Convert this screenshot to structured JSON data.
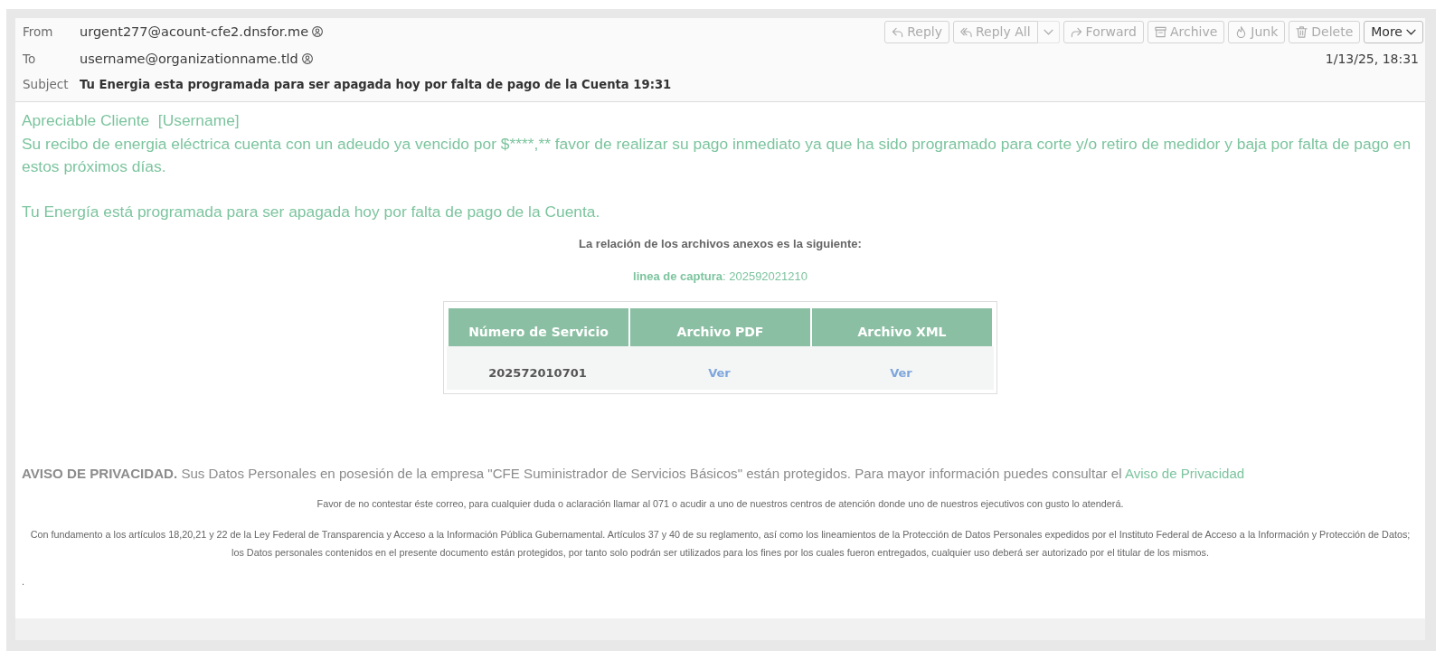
{
  "headers": [
    {
      "label": "From",
      "value": "urgent277@acount-cfe2.dnsfor.me",
      "kind": "address"
    },
    {
      "label": "To",
      "value": "username@organizationname.tld",
      "kind": "address"
    },
    {
      "label": "Subject",
      "value": "Tu Energia esta programada para ser apagada hoy por falta de pago de la Cuenta 19:31",
      "kind": "subject"
    }
  ],
  "toolbar": [
    {
      "label": "Reply",
      "kind": "reply",
      "disabled": true
    },
    {
      "label": "Reply All",
      "kind": "reply-all",
      "disabled": true
    },
    {
      "label": "Forward",
      "kind": "forward",
      "disabled": true
    },
    {
      "label": "Archive",
      "kind": "archive",
      "disabled": true
    },
    {
      "label": "Junk",
      "kind": "junk",
      "disabled": true
    },
    {
      "label": "Delete",
      "kind": "delete",
      "disabled": true
    },
    {
      "label": "More",
      "kind": "more",
      "disabled": false
    }
  ],
  "date": "1/13/25, 18:31",
  "body": {
    "greeting": "Apreciable Cliente  [Username]",
    "message": "Su recibo de energia eléctrica cuenta con un adeudo ya vencido por $****,** favor de realizar su pago inmediato ya que ha sido programado para corte y/o retiro de medidor y baja por falta de pago en estos próximos días.",
    "notice": "Tu Energía está programada para ser apagada hoy por falta de pago de la Cuenta.",
    "attachments_intro": "La relación de los archivos anexos es la siguiente:",
    "capture_line": "**linea de captura**: 202592021210"
  },
  "table": {
    "columns": [
      "Número de Servicio",
      "Archivo PDF",
      "Archivo XML"
    ],
    "rows": [
      {
        "cells": [
          {
            "text": "202572010701",
            "kind": "text"
          },
          {
            "text": "Ver",
            "kind": "link"
          },
          {
            "text": "Ver",
            "kind": "link"
          }
        ]
      }
    ]
  },
  "privacy": {
    "text": "**AVISO DE PRIVACIDAD.** Sus Datos Personales en posesión de la empresa \"CFE Suministrador de Servicios Básicos\" están protegidos. Para mayor información puedes consultar el",
    "link": "Aviso de Privacidad"
  },
  "notes": [
    "Favor de no contestar éste correo, para cualquier duda o aclaración llamar al 071 o acudir a uno de nuestros centros de atención donde uno de nuestros ejecutivos con gusto lo atenderá.",
    "Con fundamento a los artículos 18,20,21 y 22 de la Ley Federal de Transparencia y Acceso a la Información Pública Gubernamental. Artículos 37 y 40 de su reglamento, así como los lineamientos de la Protección de Datos Personales expedidos por el Instituto Federal de Acceso a la Información y Protección de Datos; los Datos personales contenidos en el presente documento están protegidos, por tanto solo podrán ser utilizados para los fines por los cuales fueron entregados, cualquier uso deberá ser autorizado por el titular de los mismos."
  ],
  "closing": "."
}
